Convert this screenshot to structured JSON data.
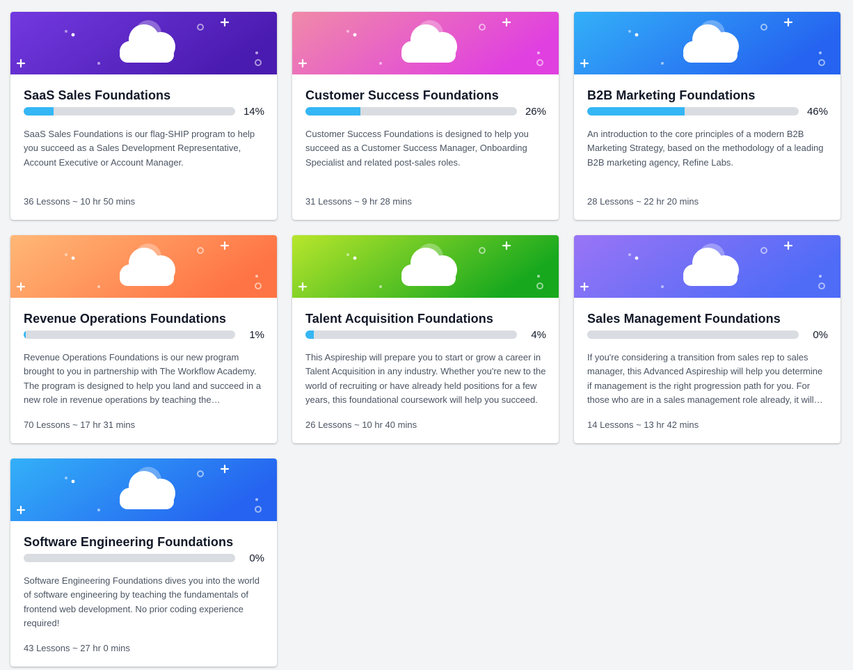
{
  "courses": [
    {
      "title": "SaaS Sales Foundations",
      "progress_percent": 14,
      "progress_label": "14%",
      "description": "SaaS Sales Foundations is our flag-SHIP program to help you succeed as a Sales Development Representative, Account Executive or Account Manager.",
      "lessons_label": "36 Lessons ~ 10 hr 50 mins",
      "gradient": [
        "#7339e0",
        "#4a1bb0"
      ]
    },
    {
      "title": "Customer Success Foundations",
      "progress_percent": 26,
      "progress_label": "26%",
      "description": "Customer Success Foundations is designed to help you succeed as a Customer Success Manager, Onboarding Specialist and related post-sales roles.",
      "lessons_label": "31 Lessons ~ 9 hr 28 mins",
      "gradient": [
        "#f08aa8",
        "#e040e0"
      ]
    },
    {
      "title": "B2B Marketing Foundations",
      "progress_percent": 46,
      "progress_label": "46%",
      "description": "An introduction to the core principles of a modern B2B Marketing Strategy, based on the methodology of a leading B2B marketing agency, Refine Labs.",
      "lessons_label": "28 Lessons ~ 22 hr 20 mins",
      "gradient": [
        "#33b0f8",
        "#2563f0"
      ]
    },
    {
      "title": "Revenue Operations Foundations",
      "progress_percent": 1,
      "progress_label": "1%",
      "description": "Revenue Operations Foundations is our new program brought to you in partnership with The Workflow Academy. The program is designed to help you land and succeed in a new role in revenue operations by teaching the fundamentals.",
      "lessons_label": "70 Lessons ~ 17 hr 31 mins",
      "gradient": [
        "#ffb877",
        "#ff7444"
      ]
    },
    {
      "title": "Talent Acquisition Foundations",
      "progress_percent": 4,
      "progress_label": "4%",
      "description": "This Aspireship will prepare you to start or grow a career in Talent Acquisition in any industry. Whether you're new to the world of recruiting or have already held positions for a few years, this foundational coursework will help you succeed.",
      "lessons_label": "26 Lessons ~ 10 hr 40 mins",
      "gradient": [
        "#b8e62c",
        "#17a81e"
      ]
    },
    {
      "title": "Sales Management Foundations",
      "progress_percent": 0,
      "progress_label": "0%",
      "description": "If you're considering a transition from sales rep to sales manager, this Advanced Aspireship will help you determine if management is the right progression path for you. For those who are in a sales management role already, it will sharpen your skills.",
      "lessons_label": "14 Lessons ~ 13 hr 42 mins",
      "gradient": [
        "#9a74f6",
        "#4f6cf7"
      ]
    },
    {
      "title": "Software Engineering Foundations",
      "progress_percent": 0,
      "progress_label": "0%",
      "description": "Software Engineering Foundations dives you into the world of software engineering by teaching the fundamentals of frontend web development. No prior coding experience required!",
      "lessons_label": "43 Lessons ~ 27 hr 0 mins",
      "gradient": [
        "#33b0f8",
        "#2563f0"
      ]
    }
  ],
  "colors": {
    "progress_fill": "#35b6f5",
    "progress_track": "#d9dce0",
    "page_background": "#f3f4f6"
  },
  "icons": {
    "banner_art": "cloud-icon"
  }
}
